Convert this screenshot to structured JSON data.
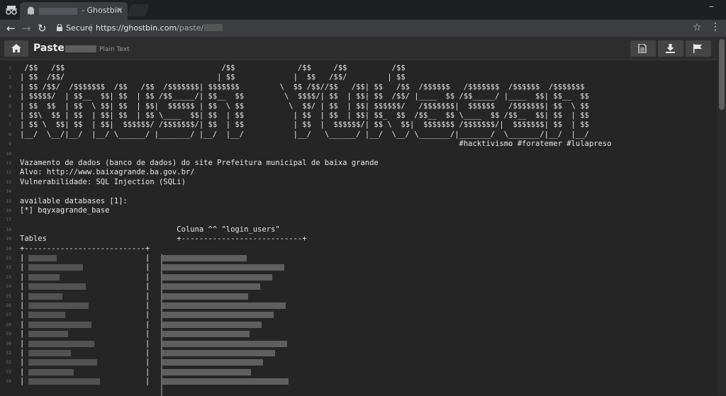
{
  "browser": {
    "tab_title": "- Ghostbin",
    "tab_close": "×",
    "secure_label": "Secure",
    "url_base": "https://ghostbin.com",
    "url_path": "/paste/"
  },
  "header": {
    "title": "Paste",
    "language": "Plain Text"
  },
  "code_lines": [
    {
      "n": "1",
      "text": " /$$   /$$                                   /$$              /$$     /$$          /$$"
    },
    {
      "n": "2",
      "text": "| $$  /$$/                                  | $$             |  $$   /$$/         | $$"
    },
    {
      "n": "3",
      "text": "| $$ /$$/  /$$$$$$$  /$$   /$$  /$$$$$$$| $$$$$$$         \\  $$ /$$//$$   /$$| $$   /$$  /$$$$$$   /$$$$$$$  /$$$$$$  /$$$$$$$"
    },
    {
      "n": "4",
      "text": "| $$$$$/  | $$__  $$| $$  | $$ /$$_____/| $$__  $$         \\  $$$$/| $$  | $$| $$  /$$/ |____  $$ /$$_____/ |____  $$| $$__  $$"
    },
    {
      "n": "5",
      "text": "| $$  $$  | $$  \\ $$| $$  | $$|  $$$$$$ | $$  \\ $$          \\  $$/ | $$  | $$| $$$$$$/   /$$$$$$$|  $$$$$$   /$$$$$$$| $$  \\ $$"
    },
    {
      "n": "6",
      "text": "| $$\\  $$ | $$  | $$| $$  | $$ \\____  $$| $$  | $$           | $$  | $$  | $$| $$_  $$  /$$__  $$ \\____  $$ /$$__  $$| $$  | $$"
    },
    {
      "n": "7",
      "text": "| $$ \\  $$| $$  | $$|  $$$$$$/ /$$$$$$$/| $$  | $$           | $$  |  $$$$$$/| $$ \\  $$|  $$$$$$$ /$$$$$$$/|  $$$$$$$| $$  | $$"
    },
    {
      "n": "8",
      "text": "|__/  \\__/|__/  |__/ \\______/ |_______/ |__/  |__/           |__/   \\______/ |__/  \\__/ \\_______/|_______/  \\_______/|__/  |__/"
    },
    {
      "n": "9",
      "text": "                                                                                                  #hacktivismo #foratemer #lulapreso"
    },
    {
      "n": "10",
      "text": ""
    },
    {
      "n": "11",
      "text": "Vazamento de dados (banco de dados) do site Prefeitura municipal de baixa grande"
    },
    {
      "n": "12",
      "text": "Alvo: http://www.baixagrande.ba.gov.br/"
    },
    {
      "n": "13",
      "text": "Vulnerabilidade: SQL Injection (SQLi)"
    },
    {
      "n": "14",
      "text": ""
    },
    {
      "n": "15",
      "text": "available databases [1]:"
    },
    {
      "n": "16",
      "text": "[*] bqyxagrande_base"
    },
    {
      "n": "17",
      "text": ""
    },
    {
      "n": "18",
      "text": "                                   Coluna ^^ \"login_users\""
    },
    {
      "n": "19",
      "text": "Tables                             +---------------------------+"
    },
    {
      "n": "20",
      "text": "+---------------------------+"
    },
    {
      "n": "21",
      "text": "|                           |"
    },
    {
      "n": "22",
      "text": "|                           |"
    },
    {
      "n": "23",
      "text": "|                           |"
    },
    {
      "n": "24",
      "text": "|                           |"
    },
    {
      "n": "25",
      "text": "|                           |"
    },
    {
      "n": "26",
      "text": "|                           |"
    },
    {
      "n": "27",
      "text": "|                           |"
    },
    {
      "n": "28",
      "text": "|                           |"
    },
    {
      "n": "29",
      "text": "|                           |"
    },
    {
      "n": "30",
      "text": "|                           |"
    },
    {
      "n": "31",
      "text": "|                           |"
    },
    {
      "n": "32",
      "text": "|                           |"
    },
    {
      "n": "33",
      "text": "|                           |"
    },
    {
      "n": "34",
      "text": "|                           |"
    }
  ]
}
